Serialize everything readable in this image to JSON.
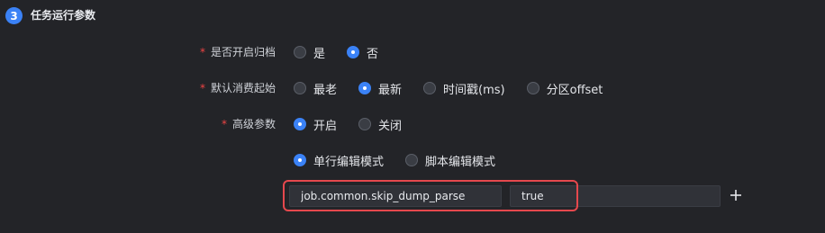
{
  "section": {
    "step_number": "3",
    "title": "任务运行参数"
  },
  "fields": {
    "archive": {
      "required_mark": "*",
      "label": "是否开启归档",
      "options": [
        {
          "label": "是",
          "checked": false
        },
        {
          "label": "否",
          "checked": true
        }
      ]
    },
    "default_consume_start": {
      "required_mark": "*",
      "label": "默认消费起始",
      "options": [
        {
          "label": "最老",
          "checked": false
        },
        {
          "label": "最新",
          "checked": true
        },
        {
          "label": "时间戳(ms)",
          "checked": false
        },
        {
          "label": "分区offset",
          "checked": false
        }
      ]
    },
    "advanced_params": {
      "required_mark": "*",
      "label": "高级参数",
      "options": [
        {
          "label": "开启",
          "checked": true
        },
        {
          "label": "关闭",
          "checked": false
        }
      ]
    },
    "edit_mode": {
      "options": [
        {
          "label": "单行编辑模式",
          "checked": true
        },
        {
          "label": "脚本编辑模式",
          "checked": false
        }
      ]
    }
  },
  "param_row": {
    "key_value": "job.common.skip_dump_parse",
    "value_value": "true",
    "extra_value": "",
    "add_icon": "plus-icon"
  },
  "colors": {
    "background": "#232428",
    "accent": "#3b82f6",
    "required": "#ef4444",
    "highlight": "#e5484d"
  }
}
